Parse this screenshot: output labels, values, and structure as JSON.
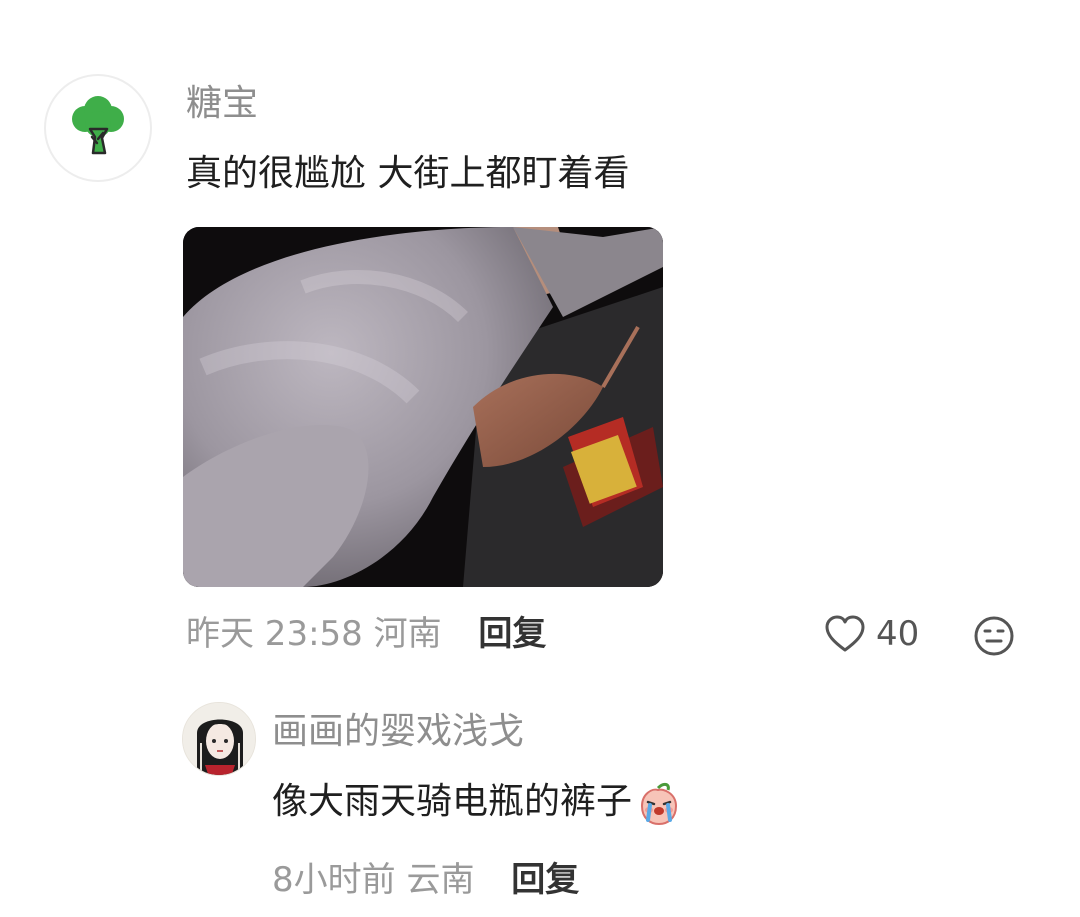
{
  "comment": {
    "avatar_icon": "broccoli-icon",
    "username": "糖宝",
    "text": "真的很尴尬 大街上都盯着看",
    "time": "昨天 23:58",
    "location": "河南",
    "reply_label": "回复",
    "like_count": "40",
    "like_icon": "heart-outline-icon",
    "emoji_icon": "emoji-face-icon"
  },
  "reply": {
    "username": "画画的婴戏浅戈",
    "text": "像大雨天骑电瓶的裤子",
    "sticker_icon": "crying-peach-sticker-icon",
    "time": "8小时前",
    "location": "云南",
    "reply_label": "回复"
  },
  "colors": {
    "username": "#8e8e8e",
    "text": "#1f1f1f",
    "meta": "#9a9a9a",
    "reply_label": "#333333",
    "broccoli_green": "#3fae49"
  }
}
